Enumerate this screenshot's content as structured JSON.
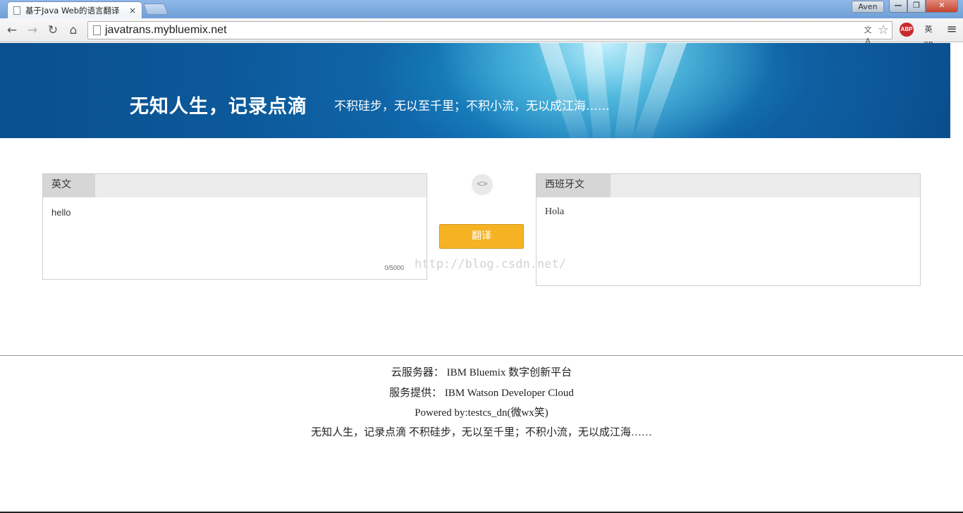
{
  "browser": {
    "tab_title": "基于Java Web的语言翻译",
    "tab_close": "×",
    "profile_name": "Aven",
    "window_buttons": {
      "minimize": "—",
      "maximize": "❐",
      "close": "✕"
    },
    "nav": {
      "back": "←",
      "forward": "→",
      "reload": "↻",
      "home": "⌂"
    },
    "url": "javatrans.mybluemix.net",
    "extensions": {
      "translate": "文A",
      "bookmark": "☆",
      "adblock": "ABP",
      "lang": "英en",
      "menu": "≡"
    }
  },
  "banner": {
    "title": "无知人生，记录点滴",
    "subtitle": "不积硅步，无以至千里；不积小流，无以成江海……"
  },
  "source": {
    "language": "英文",
    "text": "hello",
    "char_count": "0/5000"
  },
  "swap_label": "<>",
  "translate_label": "翻译",
  "target": {
    "language": "西班牙文",
    "text": "Hola"
  },
  "watermark": "http://blog.csdn.net/",
  "footer": {
    "line1": "云服务器： IBM Bluemix 数字创新平台",
    "line2": "服务提供： IBM Watson Developer Cloud",
    "line3": "Powered by:testcs_dn(微wx笑)",
    "line4": "无知人生，记录点滴 不积硅步，无以至千里；不积小流，无以成江海……"
  },
  "colors": {
    "banner": "#0d5fa0",
    "translate_button": "#f5b324",
    "adblock": "#c62a2a"
  }
}
